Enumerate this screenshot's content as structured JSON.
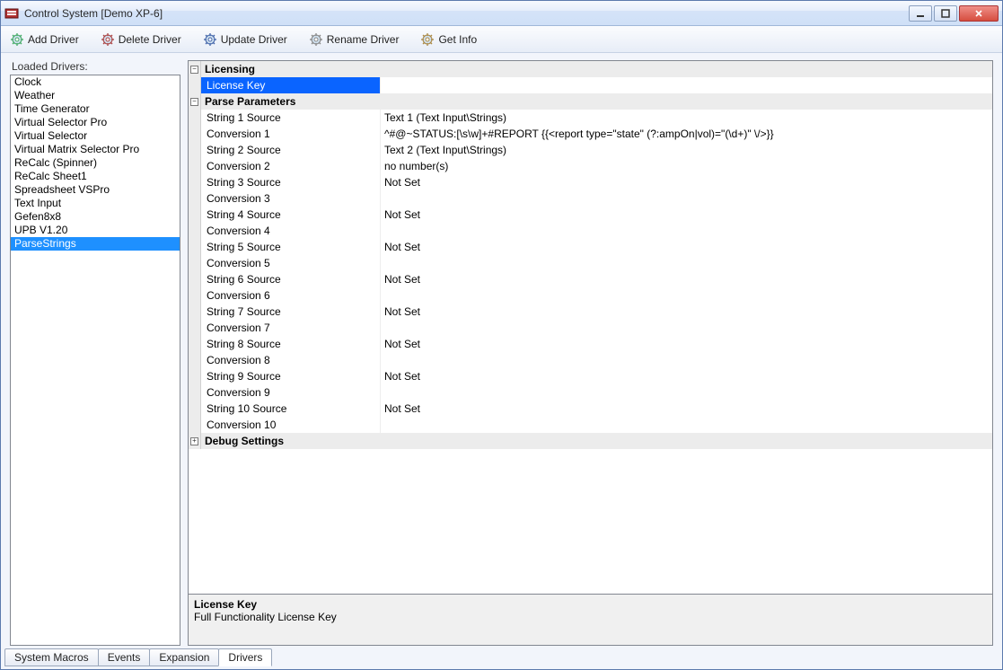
{
  "window": {
    "title": "Control System [Demo XP-6]"
  },
  "toolbar": {
    "add": "Add Driver",
    "delete": "Delete Driver",
    "update": "Update Driver",
    "rename": "Rename Driver",
    "info": "Get Info"
  },
  "left": {
    "label": "Loaded Drivers:",
    "drivers": [
      "Clock",
      "Weather",
      "Time Generator",
      "Virtual Selector Pro",
      "Virtual Selector",
      "Virtual Matrix Selector Pro",
      "ReCalc (Spinner)",
      "ReCalc Sheet1",
      "Spreadsheet VSPro",
      "Text Input",
      "Gefen8x8",
      "UPB V1.20",
      "ParseStrings"
    ],
    "selectedIndex": 12
  },
  "propgrid": {
    "categories": [
      {
        "name": "Licensing",
        "expanded": true,
        "props": [
          {
            "label": "License Key",
            "value": "",
            "selected": true
          }
        ]
      },
      {
        "name": "Parse Parameters",
        "expanded": true,
        "props": [
          {
            "label": "String 1 Source",
            "value": "Text 1 (Text Input\\Strings)"
          },
          {
            "label": "Conversion 1",
            "value": "^#@~STATUS:[\\s\\w]+#REPORT {{<report type=\"state\" (?:ampOn|vol)=\"(\\d+)\" \\/>}}"
          },
          {
            "label": "String 2 Source",
            "value": "Text 2 (Text Input\\Strings)"
          },
          {
            "label": "Conversion 2",
            "value": "no number(s)"
          },
          {
            "label": "String 3 Source",
            "value": "Not Set"
          },
          {
            "label": "Conversion 3",
            "value": ""
          },
          {
            "label": "String 4 Source",
            "value": "Not Set"
          },
          {
            "label": "Conversion 4",
            "value": ""
          },
          {
            "label": "String 5 Source",
            "value": "Not Set"
          },
          {
            "label": "Conversion 5",
            "value": ""
          },
          {
            "label": "String 6 Source",
            "value": "Not Set"
          },
          {
            "label": "Conversion 6",
            "value": ""
          },
          {
            "label": "String 7 Source",
            "value": "Not Set"
          },
          {
            "label": "Conversion 7",
            "value": ""
          },
          {
            "label": "String 8 Source",
            "value": "Not Set"
          },
          {
            "label": "Conversion 8",
            "value": ""
          },
          {
            "label": "String 9 Source",
            "value": "Not Set"
          },
          {
            "label": "Conversion 9",
            "value": ""
          },
          {
            "label": "String 10 Source",
            "value": "Not Set"
          },
          {
            "label": "Conversion 10",
            "value": ""
          }
        ]
      },
      {
        "name": "Debug Settings",
        "expanded": false,
        "props": []
      }
    ]
  },
  "description": {
    "title": "License Key",
    "text": "Full Functionality License Key"
  },
  "tabs": {
    "items": [
      "System Macros",
      "Events",
      "Expansion",
      "Drivers"
    ],
    "activeIndex": 3
  }
}
